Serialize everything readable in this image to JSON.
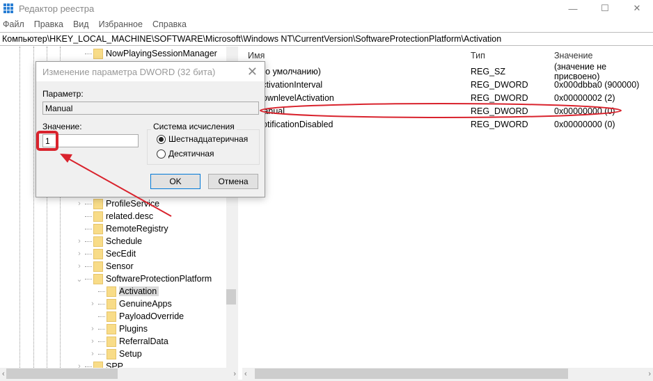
{
  "window": {
    "title": "Редактор реестра",
    "minimize": "—",
    "maximize": "☐",
    "close": "✕"
  },
  "menu": [
    "Файл",
    "Правка",
    "Вид",
    "Избранное",
    "Справка"
  ],
  "address": "Компьютер\\HKEY_LOCAL_MACHINE\\SOFTWARE\\Microsoft\\Windows NT\\CurrentVersion\\SoftwareProtectionPlatform\\Activation",
  "tree": {
    "top_item": "NowPlayingSessionManager",
    "items": [
      {
        "label": "ProfileService",
        "expander": "›"
      },
      {
        "label": "related.desc",
        "expander": ""
      },
      {
        "label": "RemoteRegistry",
        "expander": ""
      },
      {
        "label": "Schedule",
        "expander": "›"
      },
      {
        "label": "SecEdit",
        "expander": "›"
      },
      {
        "label": "Sensor",
        "expander": "›"
      },
      {
        "label": "SoftwareProtectionPlatform",
        "expander": "⌄"
      }
    ],
    "children": [
      {
        "label": "Activation",
        "expander": "",
        "selected": true
      },
      {
        "label": "GenuineApps",
        "expander": "›"
      },
      {
        "label": "PayloadOverride",
        "expander": ""
      },
      {
        "label": "Plugins",
        "expander": "›"
      },
      {
        "label": "ReferralData",
        "expander": "›"
      },
      {
        "label": "Setup",
        "expander": "›"
      }
    ],
    "partial_item": "SPP"
  },
  "list": {
    "headers": {
      "name": "Имя",
      "type": "Тип",
      "value": "Значение"
    },
    "rows": [
      {
        "name": "(По умолчанию)",
        "type": "REG_SZ",
        "value": "(значение не присвоено)"
      },
      {
        "name": "ActivationInterval",
        "type": "REG_DWORD",
        "value": "0x000dbba0 (900000)"
      },
      {
        "name": "DownlevelActivation",
        "type": "REG_DWORD",
        "value": "0x00000002 (2)"
      },
      {
        "name": "Manual",
        "type": "REG_DWORD",
        "value": "0x00000000 (0)"
      },
      {
        "name": "NotificationDisabled",
        "type": "REG_DWORD",
        "value": "0x00000000 (0)"
      }
    ]
  },
  "dialog": {
    "title": "Изменение параметра DWORD (32 бита)",
    "param_label": "Параметр:",
    "param_value": "Manual",
    "value_label": "Значение:",
    "value": "1",
    "base_label": "Система исчисления",
    "hex_label": "Шестнадцатеричная",
    "dec_label": "Десятичная",
    "hex_selected": true,
    "ok": "OK",
    "cancel": "Отмена"
  },
  "annotation_color": "#d9232d"
}
